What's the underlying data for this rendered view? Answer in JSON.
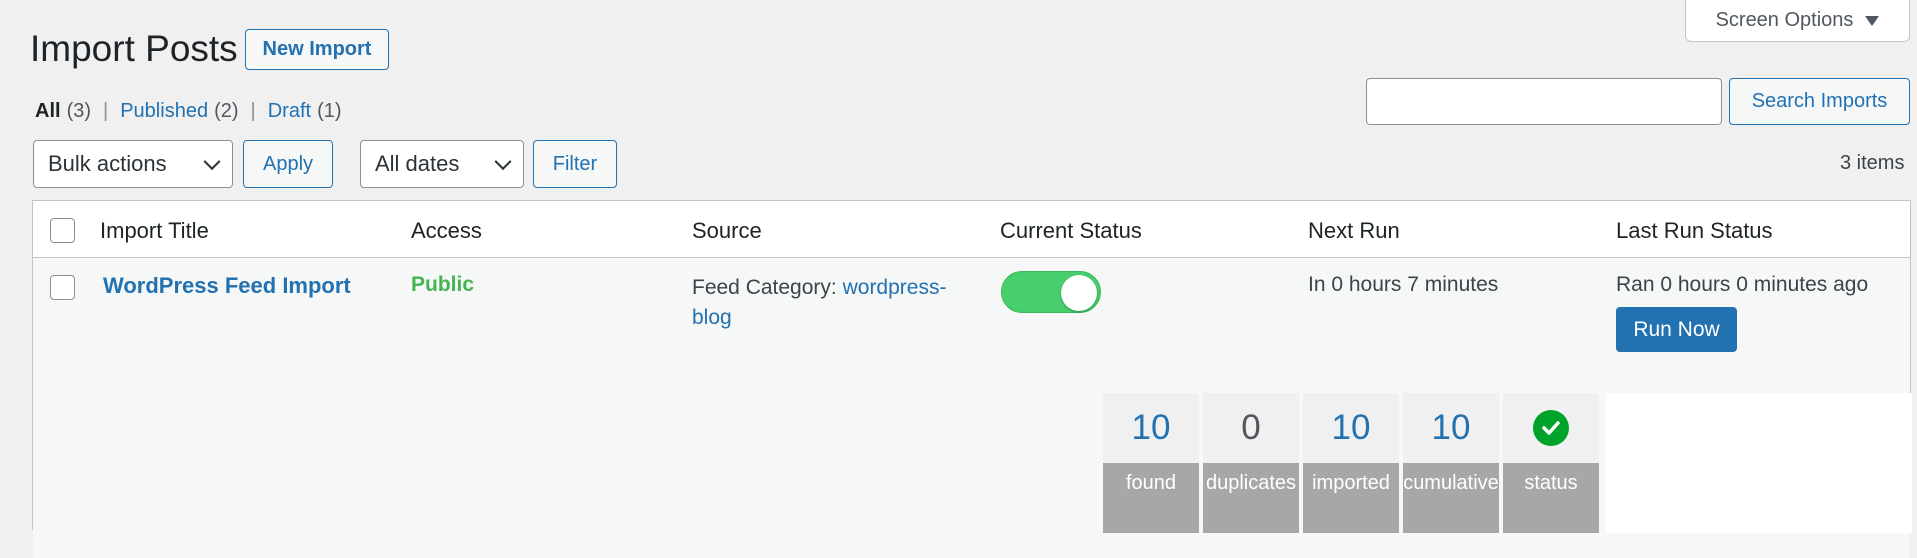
{
  "screen_options": {
    "label": "Screen Options",
    "caret_icon": "caret-down-icon"
  },
  "header": {
    "title": "Import Posts",
    "new_import_label": "New Import"
  },
  "filters": {
    "all_label": "All",
    "all_count": "(3)",
    "published_label": "Published",
    "published_count": "(2)",
    "draft_label": "Draft",
    "draft_count": "(1)",
    "separator": "|"
  },
  "search": {
    "value": "",
    "button_label": "Search Imports"
  },
  "toolbar": {
    "bulk_actions_selected": "Bulk actions",
    "apply_label": "Apply",
    "dates_selected": "All dates",
    "filter_label": "Filter",
    "items_count": "3 items"
  },
  "table": {
    "columns": [
      "Import Title",
      "Access",
      "Source",
      "Current Status",
      "Next Run",
      "Last Run Status"
    ],
    "rows": [
      {
        "title": "WordPress Feed Import",
        "access": "Public",
        "source_prefix": "Feed Category: ",
        "source_link": "wordpress-blog",
        "status_enabled": true,
        "next_run": "In 0 hours 7 minutes",
        "last_run": "Ran 0 hours 0 minutes ago",
        "run_now_label": "Run Now",
        "stats": [
          {
            "value": "10",
            "label": "found"
          },
          {
            "value": "0",
            "label": "duplicates"
          },
          {
            "value": "10",
            "label": "imported"
          },
          {
            "value": "10",
            "label": "cumulative"
          },
          {
            "icon": "check-circle-icon",
            "label": "status"
          }
        ]
      }
    ]
  },
  "colors": {
    "accent": "#2271b1",
    "public": "#46b450",
    "toggle_on": "#46cf6c",
    "success": "#00a32a"
  }
}
